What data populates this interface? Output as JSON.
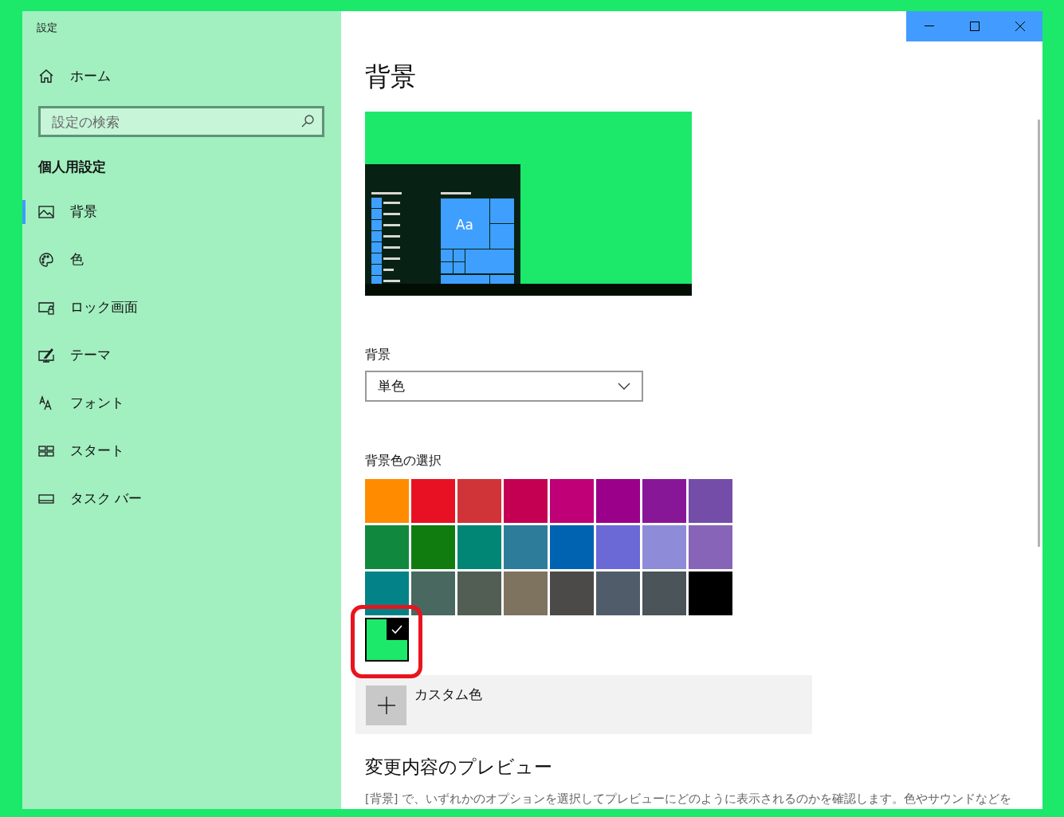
{
  "window": {
    "title": "設定"
  },
  "sidebar": {
    "home": "ホーム",
    "search": {
      "placeholder": "設定の検索"
    },
    "section": "個人用設定",
    "items": [
      {
        "label": "背景",
        "kind": "picture",
        "selected": true
      },
      {
        "label": "色",
        "kind": "palette",
        "selected": false
      },
      {
        "label": "ロック画面",
        "kind": "lock",
        "selected": false
      },
      {
        "label": "テーマ",
        "kind": "theme",
        "selected": false
      },
      {
        "label": "フォント",
        "kind": "font",
        "selected": false
      },
      {
        "label": "スタート",
        "kind": "start",
        "selected": false
      },
      {
        "label": "タスク バー",
        "kind": "taskbar",
        "selected": false
      }
    ]
  },
  "main": {
    "title": "背景",
    "preview": {
      "tile_label": "Aa"
    },
    "background_label": "背景",
    "background_dropdown": {
      "value": "単色"
    },
    "color_label": "背景色の選択",
    "swatches": [
      {
        "color": "#ff8c00",
        "selected": false
      },
      {
        "color": "#e81123",
        "selected": false
      },
      {
        "color": "#d13438",
        "selected": false
      },
      {
        "color": "#c30052",
        "selected": false
      },
      {
        "color": "#bf0077",
        "selected": false
      },
      {
        "color": "#9a0089",
        "selected": false
      },
      {
        "color": "#881798",
        "selected": false
      },
      {
        "color": "#744da9",
        "selected": false
      },
      {
        "color": "#10893e",
        "selected": false
      },
      {
        "color": "#107c10",
        "selected": false
      },
      {
        "color": "#018574",
        "selected": false
      },
      {
        "color": "#2d7d9a",
        "selected": false
      },
      {
        "color": "#0063b1",
        "selected": false
      },
      {
        "color": "#6b69d6",
        "selected": false
      },
      {
        "color": "#8e8cd8",
        "selected": false
      },
      {
        "color": "#8764b8",
        "selected": false
      },
      {
        "color": "#038387",
        "selected": false
      },
      {
        "color": "#486860",
        "selected": false
      },
      {
        "color": "#525e54",
        "selected": false
      },
      {
        "color": "#7e735f",
        "selected": false
      },
      {
        "color": "#4c4a48",
        "selected": false
      },
      {
        "color": "#515c6b",
        "selected": false
      },
      {
        "color": "#4a5459",
        "selected": false
      },
      {
        "color": "#000000",
        "selected": false
      }
    ],
    "custom_swatches": [
      {
        "color": "#1ce96a",
        "selected": true
      }
    ],
    "custom_color_button": "カスタム色",
    "preview_heading": "変更内容のプレビュー",
    "preview_description": "[背景] で、いずれかのオプションを選択してプレビューにどのように表示されるのかを確認します。色やサウンドなどを"
  }
}
